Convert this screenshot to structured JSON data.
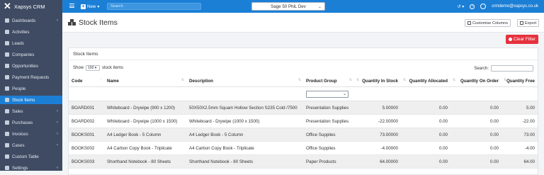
{
  "brand": {
    "name": "Xapsys CRM"
  },
  "sidebar": {
    "items": [
      {
        "label": "Dashboards",
        "icon": "gauge-icon",
        "chev": "‹"
      },
      {
        "label": "Activities",
        "icon": "calendar-icon",
        "chev": ""
      },
      {
        "label": "Leads",
        "icon": "target-icon",
        "chev": ""
      },
      {
        "label": "Companies",
        "icon": "building-icon",
        "chev": ""
      },
      {
        "label": "Opportunities",
        "icon": "lightbulb-icon",
        "chev": ""
      },
      {
        "label": "Payment Requests",
        "icon": "credit-card-icon",
        "chev": ""
      },
      {
        "label": "People",
        "icon": "users-icon",
        "chev": ""
      },
      {
        "label": "Stock Items",
        "icon": "boxes-icon",
        "chev": ""
      },
      {
        "label": "Sales",
        "icon": "sales-icon",
        "chev": "‹"
      },
      {
        "label": "Purchases",
        "icon": "cart-icon",
        "chev": "‹"
      },
      {
        "label": "Invoices",
        "icon": "invoice-icon",
        "chev": "‹"
      },
      {
        "label": "Cases",
        "icon": "briefcase-icon",
        "chev": "‹"
      },
      {
        "label": "Custom Table",
        "icon": "table-icon",
        "chev": ""
      },
      {
        "label": "Settings",
        "icon": "gear-icon",
        "chev": "‹"
      }
    ]
  },
  "topbar": {
    "new_label": "New",
    "search_placeholder": "Search",
    "database": "Sage 50 PhiL Dev",
    "user_email": "crmdemo@xapsys.co.uk"
  },
  "page": {
    "title": "Stock Items",
    "customise_label": "Customise Columns",
    "export_label": "Export",
    "clear_filter_label": "Clear Filter",
    "panel_title": "Stock Items",
    "show_label": "Show",
    "page_size": "100",
    "entries_label": "stock items",
    "search_label": "Search:"
  },
  "table": {
    "columns": [
      "Code",
      "Name",
      "Description",
      "Product Group",
      "Quantity In Stock",
      "Quantity Allocated",
      "Quantity On Order",
      "Quantity Free"
    ],
    "rows": [
      [
        "BOARD001",
        "Whiteboard - Drywipe (900 x 1200)",
        "50X50X2.5mm Squam Hollow Section S235 Cold /7500",
        "Presentation Supplies",
        "5.00000",
        "0.00",
        "0.00",
        "5.00"
      ],
      [
        "BOARD002",
        "Whiteboard - Drywipe (1000 x 1500)",
        "Whiteboard - Drywipe (1000 x 1500)",
        "Presentation Supplies",
        "-22.00000",
        "0.00",
        "0.00",
        "-22.00"
      ],
      [
        "BOOKS001",
        "A4 Ledger Book - 5 Column",
        "A4 Ledger Book - 5 Column",
        "Office Supplies",
        "73.00000",
        "0.00",
        "0.00",
        "73.00"
      ],
      [
        "BOOKS002",
        "A4 Carbon Copy Book - Triplicate",
        "A4 Carbon Copy Book - Triplicate",
        "Office Supplies",
        "-4.00000",
        "0.00",
        "0.00",
        "-4.00"
      ],
      [
        "BOOKS003",
        "Shorthand Notebook - 80 Sheets",
        "Shorthand Notebook - 80 Sheets",
        "Paper Products",
        "64.00000",
        "0.00",
        "0.00",
        "64.00"
      ]
    ]
  },
  "colors": {
    "topbar": "#1c7fd6",
    "sidebar": "#3f4b63",
    "active": "#1c7fd6",
    "clear": "#e5323d"
  }
}
